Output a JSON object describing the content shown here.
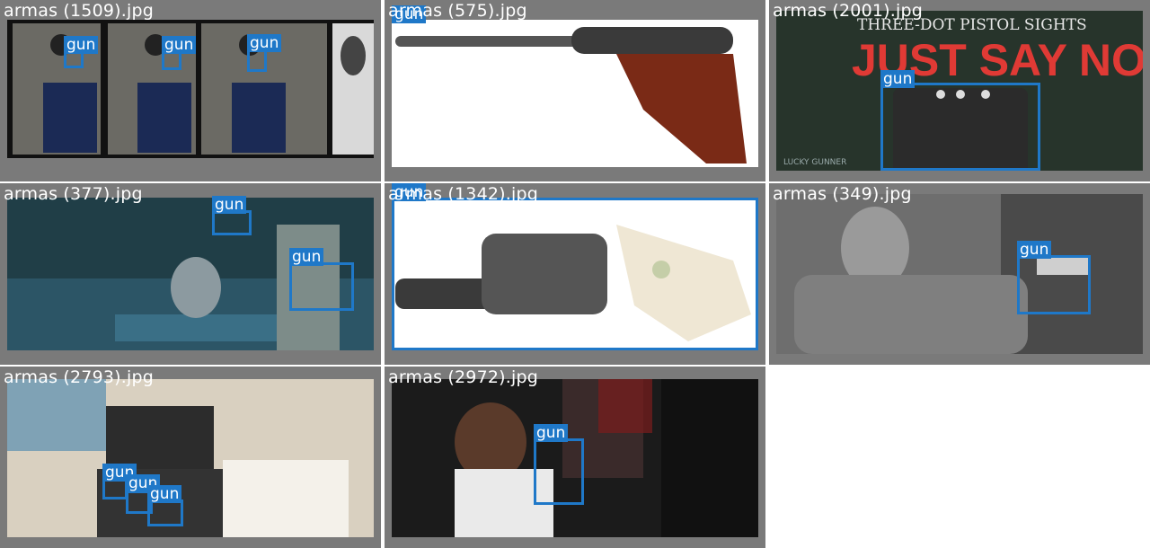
{
  "grid": {
    "cells": [
      {
        "filename": "armas (1509).jpg",
        "labels": [
          "gun",
          "gun",
          "gun"
        ]
      },
      {
        "filename": "armas (575).jpg",
        "labels": [
          "gun"
        ]
      },
      {
        "filename": "armas (2001).jpg",
        "labels": [
          "gun"
        ],
        "poster": {
          "subtitle": "THREE-DOT PISTOL SIGHTS",
          "headline": "JUST SAY NO!",
          "brand": "LUCKY GUNNER"
        }
      },
      {
        "filename": "armas (377).jpg",
        "labels": [
          "gun",
          "gun"
        ]
      },
      {
        "filename": "armas (1342).jpg",
        "labels": [
          "gun"
        ]
      },
      {
        "filename": "armas (349).jpg",
        "labels": [
          "gun"
        ]
      },
      {
        "filename": "armas (2793).jpg",
        "labels": [
          "gun",
          "gun",
          "gun"
        ]
      },
      {
        "filename": "armas (2972).jpg",
        "labels": [
          "gun"
        ]
      }
    ]
  },
  "colors": {
    "box": "#1f78c8",
    "cell_bg": "#7a7a7a",
    "label_text": "#ffffff"
  }
}
